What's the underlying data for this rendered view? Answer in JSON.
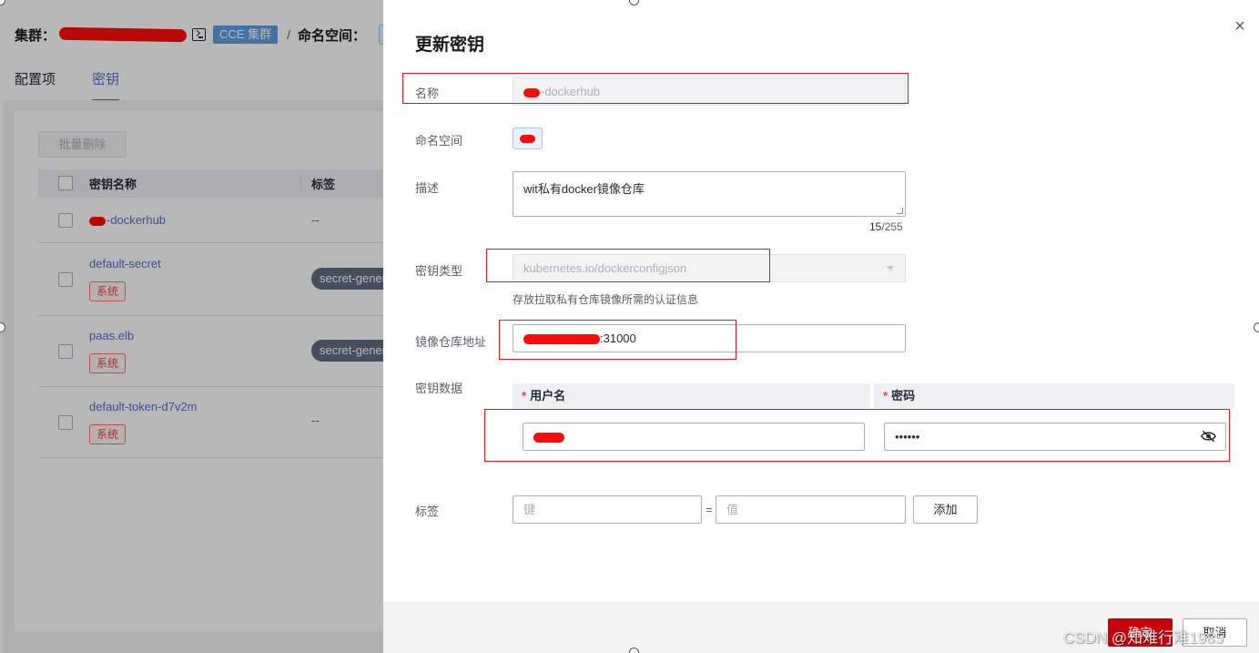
{
  "background": {
    "breadcrumb": {
      "cluster_label": "集群：",
      "cluster_tag": "CCE 集群",
      "separator": "/",
      "namespace_label": "命名空间："
    },
    "tabs": [
      {
        "label": "配置项",
        "active": false
      },
      {
        "label": "密钥",
        "active": true
      }
    ],
    "bulk_delete_label": "批量删除",
    "table": {
      "headers": {
        "name": "密钥名称",
        "label": "标签"
      },
      "rows": [
        {
          "name": "-dockerhub",
          "label": "--",
          "system_tag": ""
        },
        {
          "name": "default-secret",
          "label": "secret-generator",
          "system_tag": "系统"
        },
        {
          "name": "paas.elb",
          "label": "secret-generator",
          "system_tag": "系统"
        },
        {
          "name": "default-token-d7v2m",
          "label": "--",
          "system_tag": "系统"
        }
      ]
    }
  },
  "drawer": {
    "title": "更新密钥",
    "close_symbol": "×",
    "fields": {
      "name": {
        "label": "名称",
        "value": "-dockerhub"
      },
      "namespace": {
        "label": "命名空间"
      },
      "description": {
        "label": "描述",
        "value": "wit私有docker镜像仓库",
        "count": "15",
        "max": "/255"
      },
      "secret_type": {
        "label": "密钥类型",
        "value": "kubernetes.io/dockerconfigjson",
        "help": "存放拉取私有仓库镜像所需的认证信息"
      },
      "registry": {
        "label": "镜像仓库地址",
        "value": ":31000"
      },
      "secret_data": {
        "label": "密钥数据",
        "username_header": "用户名",
        "password_header": "密码",
        "required_mark": "*",
        "password_value": "••••••"
      },
      "tags": {
        "label": "标签",
        "key_placeholder": "键",
        "equals": "=",
        "value_placeholder": "值",
        "add_label": "添加"
      }
    },
    "footer": {
      "confirm_label": "确定",
      "cancel_label": "取消"
    }
  },
  "watermark": "CSDN @知难行难1985",
  "colors": {
    "primary_link": "#526ecc",
    "confirm_button": "#c7000b",
    "annotation_red": "#e5151b",
    "cce_tag": "#5e9fe0"
  }
}
